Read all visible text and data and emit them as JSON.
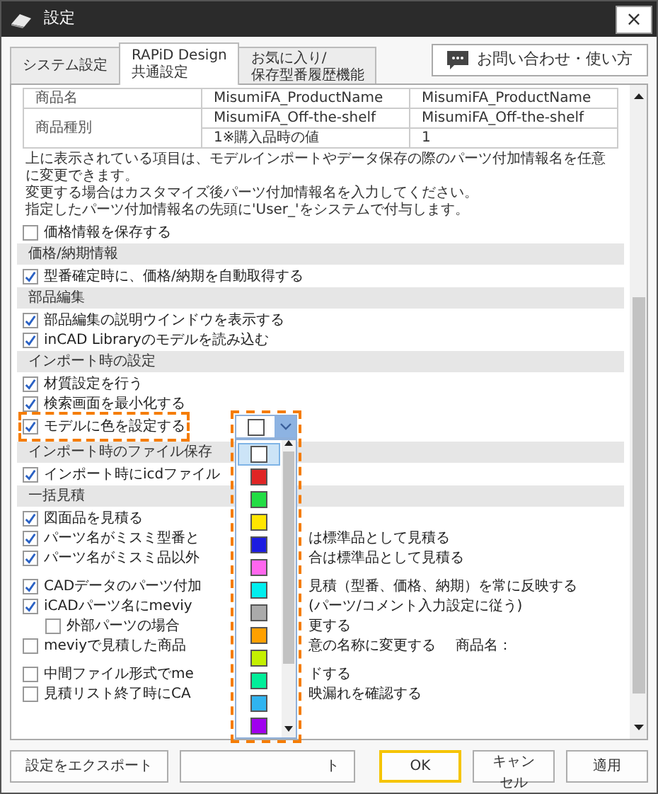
{
  "window": {
    "title": "設定",
    "close": "×"
  },
  "tabs": [
    {
      "label": "システム設定",
      "selected": false
    },
    {
      "label": "RAPiD Design\n共通設定",
      "selected": true
    },
    {
      "label": "お気に入り/\n保存型番履歴機能",
      "selected": false
    }
  ],
  "help_button": {
    "label": "お問い合わせ・使い方"
  },
  "name_table": {
    "rows": [
      {
        "cells": [
          "商品名",
          "MisumiFA_ProductName",
          "MisumiFA_ProductName"
        ]
      },
      {
        "cells": [
          {
            "text": "商品種別",
            "rowspan": 2
          },
          "MisumiFA_Off-the-shelf",
          "MisumiFA_Off-the-shelf"
        ]
      },
      {
        "cells": [
          "1※購入品時の値",
          "1"
        ]
      }
    ]
  },
  "description": [
    "上に表示されている項目は、モデルインポートやデータ保存の際のパーツ付加情報名を任意に変更できます。",
    "変更する場合はカスタマイズ後パーツ付加情報名を入力してください。",
    "指定したパーツ付加情報名の先頭に'User_'をシステムで付与します。"
  ],
  "items": [
    {
      "kind": "check",
      "label": "価格情報を保存する",
      "checked": false
    },
    {
      "kind": "heading",
      "label": "価格/納期情報"
    },
    {
      "kind": "check",
      "label": "型番確定時に、価格/納期を自動取得する",
      "checked": true
    },
    {
      "kind": "heading",
      "label": "部品編集"
    },
    {
      "kind": "check",
      "label": "部品編集の説明ウインドウを表示する",
      "checked": true
    },
    {
      "kind": "check",
      "label": "inCAD Libraryのモデルを読み込む",
      "checked": true
    },
    {
      "kind": "heading",
      "label": "インポート時の設定"
    },
    {
      "kind": "check",
      "label": "材質設定を行う",
      "checked": true
    },
    {
      "kind": "check",
      "label": "検索画面を最小化する",
      "checked": true
    },
    {
      "kind": "color_check",
      "label": "モデルに色を設定する",
      "checked": true,
      "highlighted": true
    },
    {
      "kind": "heading",
      "label": "インポート時のファイル保存"
    },
    {
      "kind": "check",
      "label": "インポート時にicdファイル",
      "checked": true
    },
    {
      "kind": "heading",
      "label": "一括見積"
    },
    {
      "kind": "check",
      "label": "図面品を見積る",
      "checked": true
    },
    {
      "kind": "check",
      "label": "パーツ名がミスミ型番と",
      "label_after": "は標準品として見積る",
      "checked": true
    },
    {
      "kind": "check",
      "label": "パーツ名がミスミ品以外",
      "label_after": "合は標準品として見積る",
      "checked": true
    },
    {
      "kind": "check",
      "label": "CADデータのパーツ付加",
      "label_after": "見積（型番、価格、納期）を常に反映する",
      "checked": true,
      "gap_before": true
    },
    {
      "kind": "check",
      "label": "iCADパーツ名にmeviy",
      "label_after": "(パーツ/コメント入力設定に従う)",
      "checked": true,
      "children": [
        {
          "kind": "check",
          "label": "外部パーツの場合",
          "label_after": "更する",
          "checked": false
        }
      ]
    },
    {
      "kind": "check",
      "label": "meviyで見積した商品",
      "label_after": "意の名称に変更する",
      "note": "商品名：",
      "checked": false
    },
    {
      "kind": "check",
      "label": "中間ファイル形式でme",
      "label_after": "ドする",
      "checked": false,
      "gap_before": true
    },
    {
      "kind": "check",
      "label": "見積リスト終了時にCA",
      "label_after": "映漏れを確認する",
      "checked": false
    }
  ],
  "color_dropdown": {
    "combo": {
      "color": "#ffffff"
    },
    "highlighted": true,
    "options": [
      {
        "color": "#ffffff",
        "selected": true
      },
      {
        "color": "#e02424",
        "selected": false
      },
      {
        "color": "#22dd44",
        "selected": false
      },
      {
        "color": "#ffe600",
        "selected": false
      },
      {
        "color": "#1c1ce0",
        "selected": false
      },
      {
        "color": "#ff66ee",
        "selected": false
      },
      {
        "color": "#00eeee",
        "selected": false
      },
      {
        "color": "#aaaaaa",
        "selected": false
      },
      {
        "color": "#ffa000",
        "selected": false
      },
      {
        "color": "#c4f000",
        "selected": false
      },
      {
        "color": "#00ee99",
        "selected": false
      },
      {
        "color": "#30b4f0",
        "selected": false
      },
      {
        "color": "#a000ee",
        "selected": false
      }
    ]
  },
  "footer": {
    "left": [
      {
        "label": "設定をエクスポート",
        "kind": "plain"
      },
      {
        "label": "ト",
        "kind": "covered"
      }
    ],
    "right": [
      {
        "label": "OK",
        "default": true
      },
      {
        "label": "キャンセル",
        "default": false
      },
      {
        "label": "適用",
        "default": false
      }
    ]
  }
}
